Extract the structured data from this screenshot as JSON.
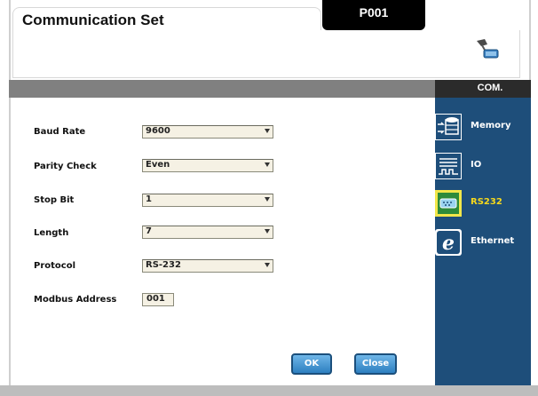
{
  "window": {
    "title": "Communication Set",
    "page_id": "P001",
    "section_label": "COM."
  },
  "form": {
    "rows": [
      {
        "label": "Baud Rate",
        "value": "9600"
      },
      {
        "label": "Parity Check",
        "value": "Even"
      },
      {
        "label": "Stop Bit",
        "value": "1"
      },
      {
        "label": "Length",
        "value": "7"
      },
      {
        "label": "Protocol",
        "value": "RS-232"
      }
    ],
    "modbus_address": {
      "label": "Modbus Address",
      "value": "001"
    }
  },
  "buttons": {
    "ok": "OK",
    "close": "Close"
  },
  "sidebar": {
    "items": [
      {
        "label": "Memory",
        "icon": "memory-icon",
        "active": false
      },
      {
        "label": "IO",
        "icon": "io-icon",
        "active": false
      },
      {
        "label": "RS232",
        "icon": "rs232-icon",
        "active": true
      },
      {
        "label": "Ethernet",
        "icon": "ethernet-icon",
        "active": false
      }
    ]
  },
  "colors": {
    "sidebar_bg": "#1e4e7a",
    "active_label": "#f6d81c",
    "button_blue": "#2d7fc0",
    "field_bg": "#f5f1e4"
  }
}
